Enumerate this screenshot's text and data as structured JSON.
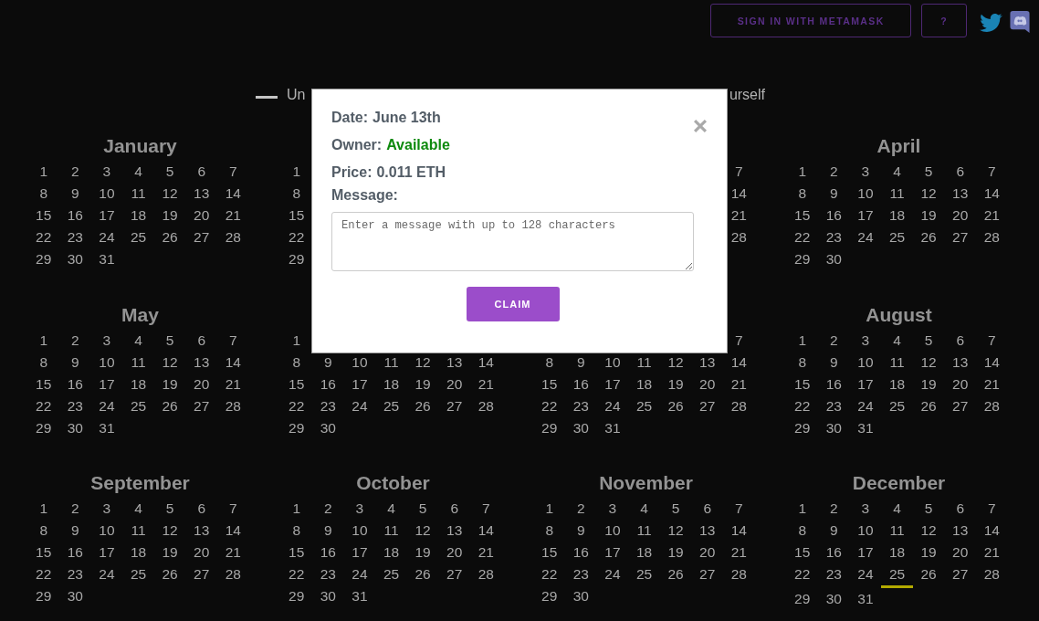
{
  "header": {
    "buttons": [
      {
        "label": "SIGN IN WITH METAMASK"
      },
      {
        "label": "?"
      }
    ]
  },
  "legend": [
    {
      "label": "Un",
      "color": "#c4c4c4"
    },
    {
      "label": "urself"
    }
  ],
  "calendar": {
    "months": [
      {
        "name": "January",
        "weeks": [
          [
            "1",
            "2",
            "3",
            "4",
            "5",
            "6",
            "7"
          ],
          [
            "8",
            "9",
            "10",
            "11",
            "12",
            "13",
            "14"
          ],
          [
            "15",
            "16",
            "17",
            "18",
            "19",
            "20",
            "21"
          ],
          [
            "22",
            "23",
            "24",
            "25",
            "26",
            "27",
            "28"
          ],
          [
            "29",
            "30",
            "31"
          ]
        ]
      },
      {
        "weeks": [
          [
            "1"
          ],
          [
            "8"
          ],
          [
            "15"
          ],
          [
            "22"
          ],
          [
            "29"
          ]
        ]
      },
      {
        "weeks": [
          {
            "kind": "end",
            "days": [
              "7"
            ]
          },
          {
            "kind": "end",
            "days": [
              "14"
            ]
          },
          {
            "kind": "end",
            "days": [
              "21"
            ]
          },
          {
            "kind": "end",
            "days": [
              "28"
            ]
          }
        ]
      },
      {
        "name": "April",
        "weeks": [
          [
            "1",
            "2",
            "3",
            "4",
            "5",
            "6",
            "7"
          ],
          [
            "8",
            "9",
            "10",
            "11",
            "12",
            "13",
            "14"
          ],
          [
            "15",
            "16",
            "17",
            "18",
            "19",
            "20",
            "21"
          ],
          [
            "22",
            "23",
            "24",
            "25",
            "26",
            "27",
            "28"
          ],
          [
            "29",
            "30"
          ]
        ]
      },
      {
        "name": "May",
        "weeks": [
          [
            "1",
            "2",
            "3",
            "4",
            "5",
            "6",
            "7"
          ],
          [
            "8",
            "9",
            "10",
            "11",
            "12",
            "13",
            "14"
          ],
          [
            "15",
            "16",
            "17",
            "18",
            "19",
            "20",
            "21"
          ],
          [
            "22",
            "23",
            "24",
            "25",
            "26",
            "27",
            "28"
          ],
          [
            "29",
            "30",
            "31"
          ]
        ]
      },
      {
        "weeks": [
          [
            "1"
          ],
          [
            "8",
            "9",
            "10",
            "11",
            "12",
            "13",
            "14"
          ],
          [
            "15",
            "16",
            "17",
            "18",
            "19",
            "20",
            "21"
          ],
          [
            "22",
            "23",
            "24",
            "25",
            "26",
            "27",
            "28"
          ],
          [
            "29",
            "30"
          ]
        ]
      },
      {
        "weeks": [
          {
            "kind": "end",
            "days": [
              "7"
            ]
          },
          [
            "8",
            "9",
            "10",
            "11",
            "12",
            "13",
            "14"
          ],
          [
            "15",
            "16",
            "17",
            "18",
            "19",
            "20",
            "21"
          ],
          [
            "22",
            "23",
            "24",
            "25",
            "26",
            "27",
            "28"
          ],
          [
            "29",
            "30",
            "31"
          ]
        ]
      },
      {
        "name": "August",
        "weeks": [
          [
            "1",
            "2",
            "3",
            "4",
            "5",
            "6",
            "7"
          ],
          [
            "8",
            "9",
            "10",
            "11",
            "12",
            "13",
            "14"
          ],
          [
            "15",
            "16",
            "17",
            "18",
            "19",
            "20",
            "21"
          ],
          [
            "22",
            "23",
            "24",
            "25",
            "26",
            "27",
            "28"
          ],
          [
            "29",
            "30",
            "31"
          ]
        ]
      },
      {
        "name": "September",
        "weeks": [
          [
            "1",
            "2",
            "3",
            "4",
            "5",
            "6",
            "7"
          ],
          [
            "8",
            "9",
            "10",
            "11",
            "12",
            "13",
            "14"
          ],
          [
            "15",
            "16",
            "17",
            "18",
            "19",
            "20",
            "21"
          ],
          [
            "22",
            "23",
            "24",
            "25",
            "26",
            "27",
            "28"
          ],
          [
            "29",
            "30"
          ]
        ]
      },
      {
        "name": "October",
        "weeks": [
          [
            "1",
            "2",
            "3",
            "4",
            "5",
            "6",
            "7"
          ],
          [
            "8",
            "9",
            "10",
            "11",
            "12",
            "13",
            "14"
          ],
          [
            "15",
            "16",
            "17",
            "18",
            "19",
            "20",
            "21"
          ],
          [
            "22",
            "23",
            "24",
            "25",
            "26",
            "27",
            "28"
          ],
          [
            "29",
            "30",
            "31"
          ]
        ]
      },
      {
        "name": "November",
        "weeks": [
          [
            "1",
            "2",
            "3",
            "4",
            "5",
            "6",
            "7"
          ],
          [
            "8",
            "9",
            "10",
            "11",
            "12",
            "13",
            "14"
          ],
          [
            "15",
            "16",
            "17",
            "18",
            "19",
            "20",
            "21"
          ],
          [
            "22",
            "23",
            "24",
            "25",
            "26",
            "27",
            "28"
          ],
          [
            "29",
            "30"
          ]
        ]
      },
      {
        "name": "December",
        "weeks": [
          [
            "1",
            "2",
            "3",
            "4",
            "5",
            "6",
            "7"
          ],
          [
            "8",
            "9",
            "10",
            "11",
            "12",
            "13",
            "14"
          ],
          [
            "15",
            "16",
            "17",
            "18",
            "19",
            "20",
            "21"
          ],
          [
            "22",
            "23",
            "24",
            {
              "label": "25",
              "color": "#b3aa00"
            },
            "26",
            "27",
            "28"
          ],
          [
            "29",
            "30",
            "31"
          ]
        ]
      }
    ]
  },
  "modal": {
    "fields": [
      {
        "label": "Date:",
        "value": "June 13th"
      },
      {
        "label": "Owner:",
        "value": "Available",
        "color": "#0e8a0e"
      },
      {
        "label": "Price:",
        "value": "0.011 ETH"
      },
      {
        "label": "Message:"
      }
    ],
    "message": {
      "placeholder": "Enter a message with up to 128 characters"
    },
    "button": "CLAIM"
  }
}
